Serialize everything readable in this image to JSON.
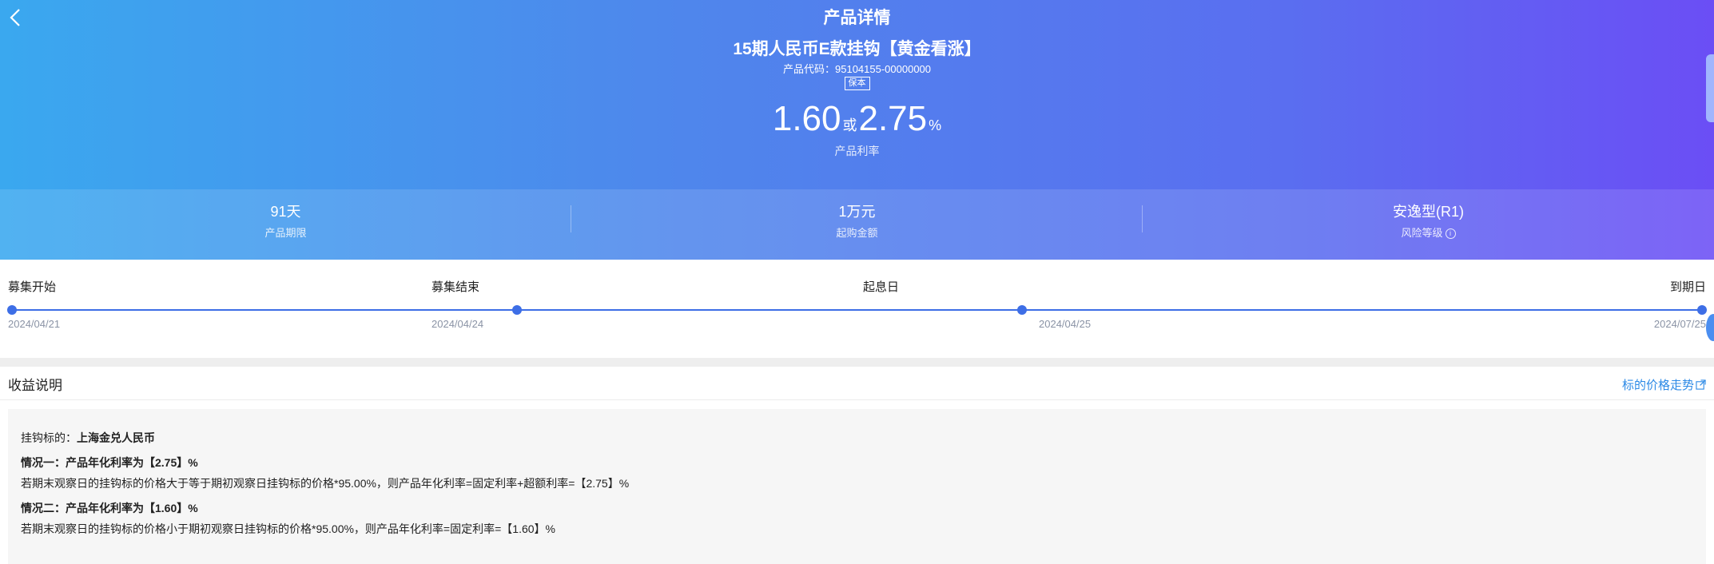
{
  "header": {
    "page_title": "产品详情",
    "product_name": "15期人民币E款挂钩【黄金看涨】",
    "code_label": "产品代码：",
    "code_value": "95104155-00000000",
    "badge": "保本",
    "rate_low": "1.60",
    "rate_or": "或",
    "rate_high": "2.75",
    "rate_unit": "%",
    "rate_label": "产品利率"
  },
  "stats": [
    {
      "value": "91天",
      "label": "产品期限"
    },
    {
      "value": "1万元",
      "label": "起购金额"
    },
    {
      "value": "安逸型(R1)",
      "label": "风险等级"
    }
  ],
  "timeline": {
    "labels": [
      "募集开始",
      "募集结束",
      "起息日",
      "到期日"
    ],
    "dates": [
      "2024/04/21",
      "2024/04/24",
      "2024/04/25",
      "2024/07/25"
    ]
  },
  "income": {
    "title": "收益说明",
    "trend_link": "标的价格走势",
    "underlying_label": "挂钩标的：",
    "underlying_value": "上海金兑人民币",
    "case1_title": "情况一：产品年化利率为【2.75】%",
    "case1_desc": "若期末观察日的挂钩标的价格大于等于期初观察日挂钩标的价格*95.00%，则产品年化利率=固定利率+超额利率=【2.75】%",
    "case2_title": "情况二：产品年化利率为【1.60】%",
    "case2_desc": "若期末观察日的挂钩标的价格小于期初观察日挂钩标的价格*95.00%，则产品年化利率=固定利率=【1.60】%"
  },
  "icons": {
    "back": "chevron-left-icon",
    "info": "info-circle-icon",
    "external": "external-link-icon"
  },
  "colors": {
    "gradient_start": "#3aa8ef",
    "gradient_end": "#6b4ef5",
    "accent": "#3d6ee6",
    "link": "#2d8ae6"
  }
}
